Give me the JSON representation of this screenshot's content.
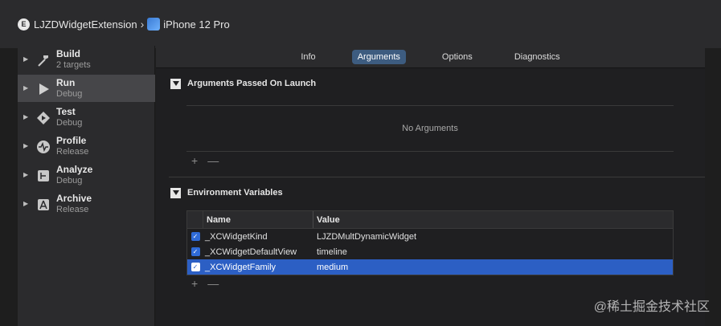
{
  "scheme_bar": {
    "scheme_name": "LJZDWidgetExtension",
    "device_name": "iPhone 12 Pro",
    "extension_icon_letter": "E"
  },
  "sidebar": {
    "actions": [
      {
        "title": "Build",
        "subtitle": "2 targets",
        "icon": "hammer-icon",
        "selected": false
      },
      {
        "title": "Run",
        "subtitle": "Debug",
        "icon": "play-icon",
        "selected": true
      },
      {
        "title": "Test",
        "subtitle": "Debug",
        "icon": "diamond-play-icon",
        "selected": false
      },
      {
        "title": "Profile",
        "subtitle": "Release",
        "icon": "waveform-icon",
        "selected": false
      },
      {
        "title": "Analyze",
        "subtitle": "Debug",
        "icon": "analyze-icon",
        "selected": false
      },
      {
        "title": "Archive",
        "subtitle": "Release",
        "icon": "archive-icon",
        "selected": false
      }
    ]
  },
  "tabs": [
    {
      "label": "Info",
      "active": false
    },
    {
      "label": "Arguments",
      "active": true
    },
    {
      "label": "Options",
      "active": false
    },
    {
      "label": "Diagnostics",
      "active": false
    }
  ],
  "arguments": {
    "header": "Arguments Passed On Launch",
    "empty_text": "No Arguments"
  },
  "environment": {
    "header": "Environment Variables",
    "col_name": "Name",
    "col_value": "Value",
    "rows": [
      {
        "name": "_XCWidgetKind",
        "value": "LJZDMultDynamicWidget",
        "checked": true,
        "selected": false
      },
      {
        "name": "_XCWidgetDefaultView",
        "value": "timeline",
        "checked": true,
        "selected": false
      },
      {
        "name": "_XCWidgetFamily",
        "value": "medium",
        "checked": true,
        "selected": true
      }
    ]
  },
  "controls": {
    "plus": "+",
    "minus": "—"
  },
  "colors": {
    "selection_blue": "#2c5fc4",
    "active_tab": "#3d5c80",
    "checkbox_blue": "#2f6bd8"
  },
  "watermark": "@稀土掘金技术社区"
}
